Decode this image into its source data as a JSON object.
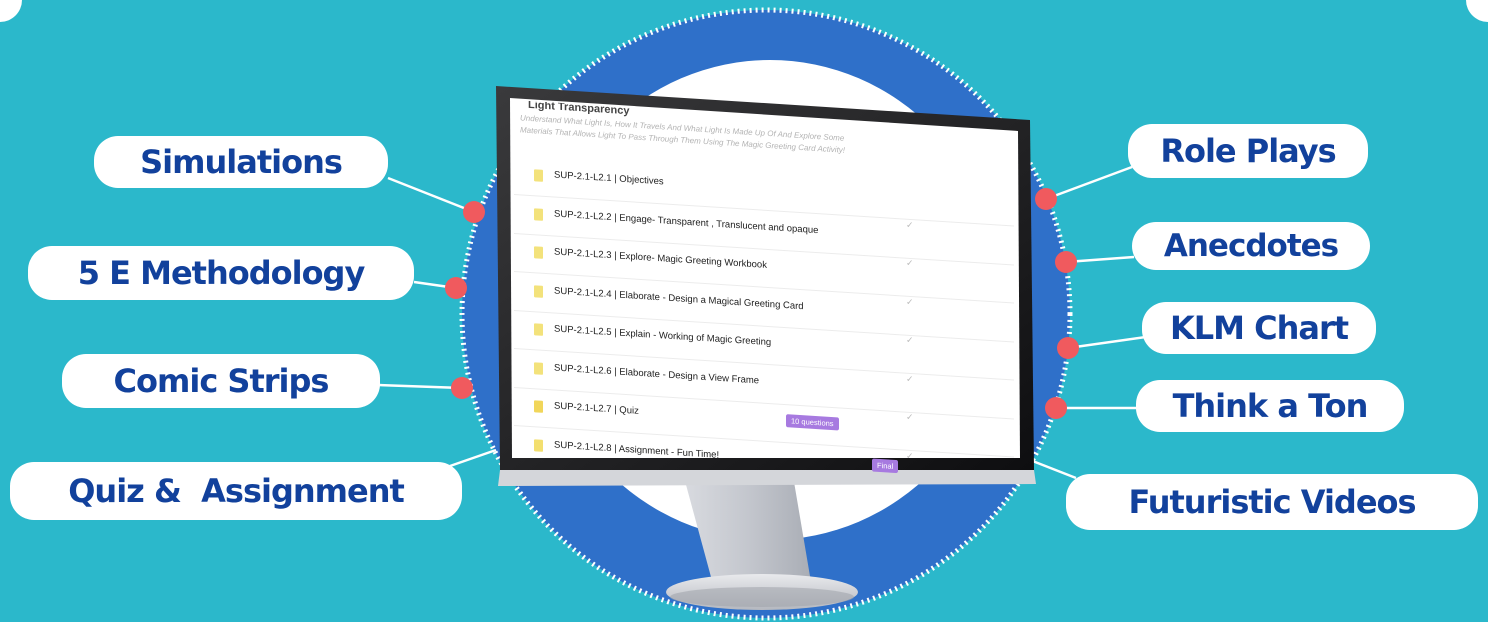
{
  "colors": {
    "background": "#2bb8cb",
    "circle": "#2f70c9",
    "pill_text": "#12419c",
    "pill_bg": "#ffffff",
    "dot": "#f05a5e"
  },
  "features_left": [
    {
      "label": "Simulations"
    },
    {
      "label": "5 E Methodology"
    },
    {
      "label": "Comic Strips"
    },
    {
      "label": "Quiz &  Assignment"
    }
  ],
  "features_right": [
    {
      "label": "Role Plays"
    },
    {
      "label": "Anecdotes"
    },
    {
      "label": "KLM Chart"
    },
    {
      "label": "Think a Ton"
    },
    {
      "label": "Futuristic Videos"
    }
  ],
  "screen": {
    "heading": "Light Transparency",
    "description_line1": "Understand What Light Is, How It Travels And What Light Is Made Up Of And Explore Some",
    "description_line2": "Materials That Allows Light To Pass Through Them Using The Magic Greeting Card Activity!",
    "lessons": [
      {
        "title": "SUP-2.1-L2.1 | Objectives",
        "icon": "document-icon",
        "checked": false
      },
      {
        "title": "SUP-2.1-L2.2 | Engage- Transparent , Translucent and opaque",
        "icon": "document-icon",
        "checked": true
      },
      {
        "title": "SUP-2.1-L2.3 | Explore- Magic Greeting Workbook",
        "icon": "document-icon",
        "checked": true
      },
      {
        "title": "SUP-2.1-L2.4 | Elaborate - Design a Magical Greeting Card",
        "icon": "document-icon",
        "checked": true
      },
      {
        "title": "SUP-2.1-L2.5 | Explain - Working of Magic Greeting",
        "icon": "document-icon",
        "checked": true
      },
      {
        "title": "SUP-2.1-L2.6 | Elaborate - Design a View Frame",
        "icon": "document-icon",
        "checked": true
      },
      {
        "title": "SUP-2.1-L2.7 | Quiz",
        "icon": "quiz-icon",
        "badge": "10 questions",
        "checked": true
      },
      {
        "title": "SUP-2.1-L2.8 | Assignment - Fun Time!",
        "icon": "assignment-icon",
        "badge": "Final",
        "checked": true
      }
    ]
  }
}
